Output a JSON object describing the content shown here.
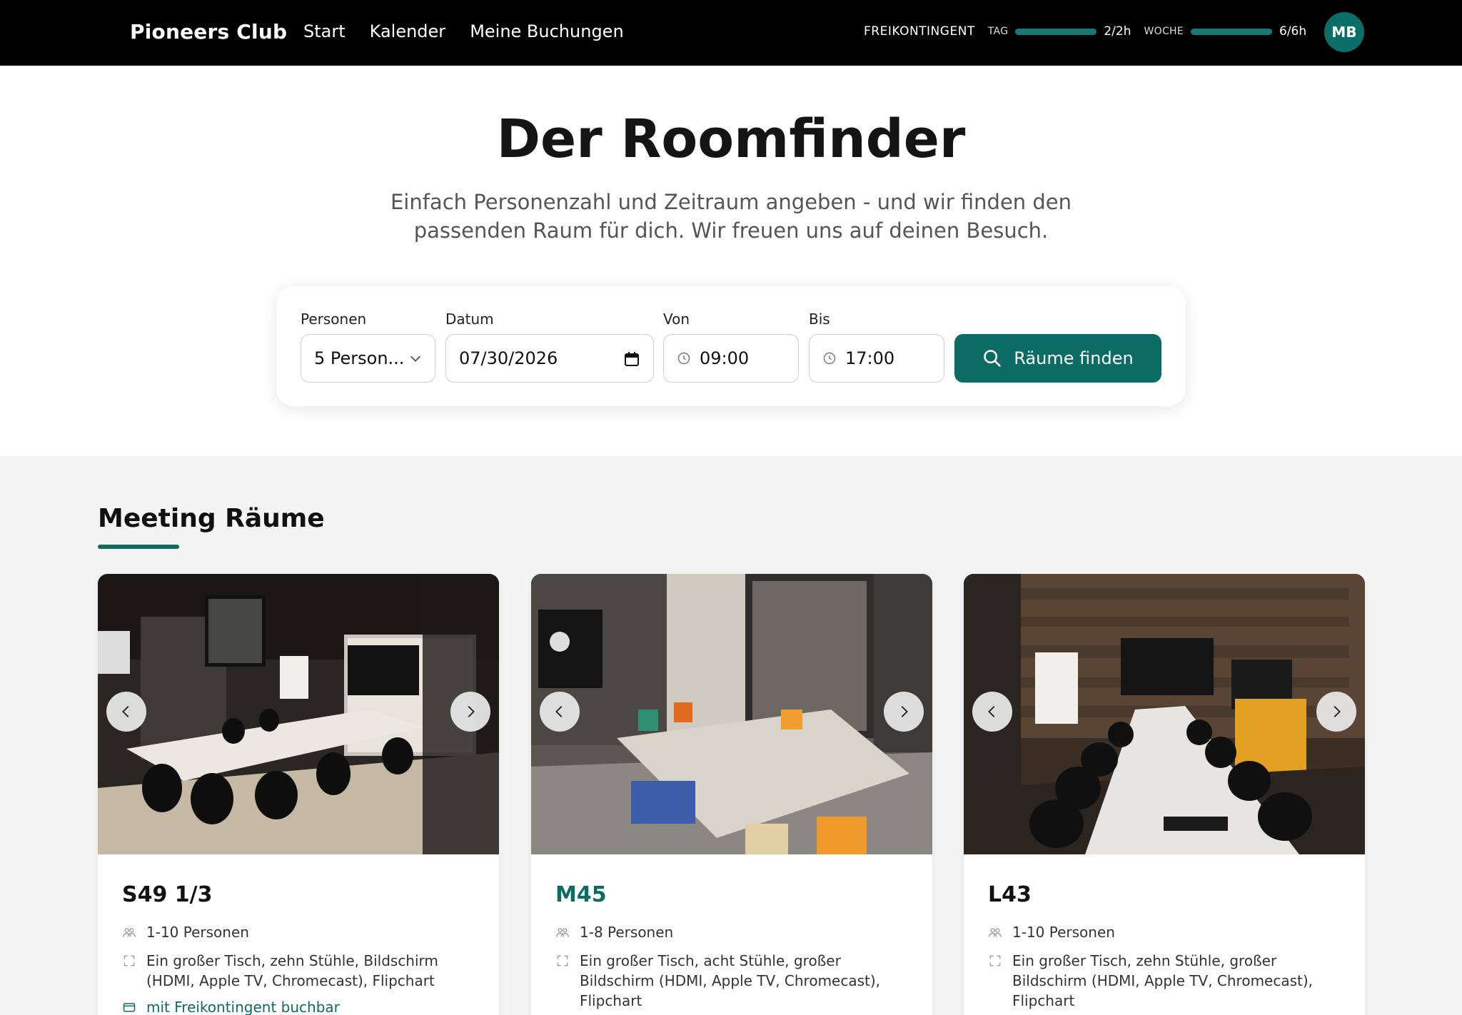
{
  "header": {
    "brand": "Pioneers Club",
    "nav": [
      "Start",
      "Kalender",
      "Meine Buchungen"
    ],
    "quota": {
      "label": "FREIKONTINGENT",
      "day_label": "TAG",
      "day_value": "2/2h",
      "day_fraction": 1.0,
      "week_label": "WOCHE",
      "week_value": "6/6h",
      "week_fraction": 1.0
    },
    "avatar_initials": "MB"
  },
  "hero": {
    "title": "Der Roomfinder",
    "subtitle_line1": "Einfach Personenzahl und Zeitraum angeben - und wir finden den",
    "subtitle_line2": "passenden Raum für dich. Wir freuen uns auf deinen Besuch."
  },
  "search": {
    "persons_label": "Personen",
    "persons_value": "5 Person...",
    "date_label": "Datum",
    "date_value": "07/30/2026",
    "from_label": "Von",
    "from_value": "09:00",
    "to_label": "Bis",
    "to_value": "17:00",
    "button_label": "Räume finden"
  },
  "rooms": {
    "section_title": "Meeting Räume",
    "items": [
      {
        "name": "S49 1/3",
        "capacity": "1-10 Personen",
        "equipment": "Ein großer Tisch, zehn Stühle, Bildschirm (HDMI, Apple TV, Chromecast), Flipchart",
        "quota_note": "mit Freikontingent buchbar"
      },
      {
        "name": "M45",
        "capacity": "1-8 Personen",
        "equipment": "Ein großer Tisch, acht Stühle, großer Bildschirm (HDMI, Apple TV, Chromecast), Flipchart"
      },
      {
        "name": "L43",
        "capacity": "1-10 Personen",
        "equipment": "Ein großer Tisch, zehn Stühle, großer Bildschirm (HDMI, Apple TV, Chromecast), Flipchart"
      }
    ]
  },
  "colors": {
    "accent": "#0b6b65",
    "header_bg": "#000000",
    "section_bg": "#f4f4f4"
  },
  "icons": [
    "chevron-down-icon",
    "calendar-icon",
    "clock-icon",
    "search-icon",
    "chevron-left-icon",
    "chevron-right-icon",
    "people-icon",
    "expand-icon",
    "card-icon"
  ]
}
